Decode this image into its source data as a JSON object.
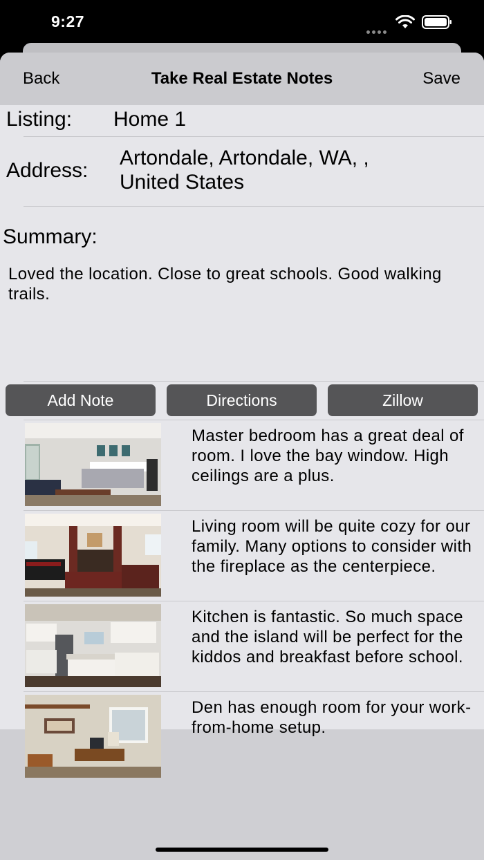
{
  "status": {
    "time": "9:27"
  },
  "nav": {
    "back_label": "Back",
    "title": "Take Real Estate Notes",
    "save_label": "Save"
  },
  "listing": {
    "label": "Listing:",
    "value": "Home 1"
  },
  "address": {
    "label": "Address:",
    "line1": "Artondale, Artondale,  WA, ,",
    "line2": "United States"
  },
  "summary": {
    "label": "Summary:",
    "text": "Loved the location. Close to great schools. Good walking trails."
  },
  "actions": {
    "add_note": "Add Note",
    "directions": "Directions",
    "zillow": "Zillow"
  },
  "notes": [
    {
      "photo": "master-bedroom-photo",
      "text": "Master bedroom has a great deal of room. I love the bay window. High ceilings are a plus."
    },
    {
      "photo": "living-room-photo",
      "text": "Living room will be quite cozy for our family. Many options to consider with the fireplace as the centerpiece."
    },
    {
      "photo": "kitchen-photo",
      "text": "Kitchen is fantastic. So much space and the island will be perfect for the kiddos and breakfast before school."
    },
    {
      "photo": "den-photo",
      "text": "Den has enough room for your work-from-home setup."
    }
  ],
  "colors": {
    "button_bg": "#555557",
    "content_bg": "#e6e6ea",
    "sheet_bg": "#cfcfd3"
  }
}
